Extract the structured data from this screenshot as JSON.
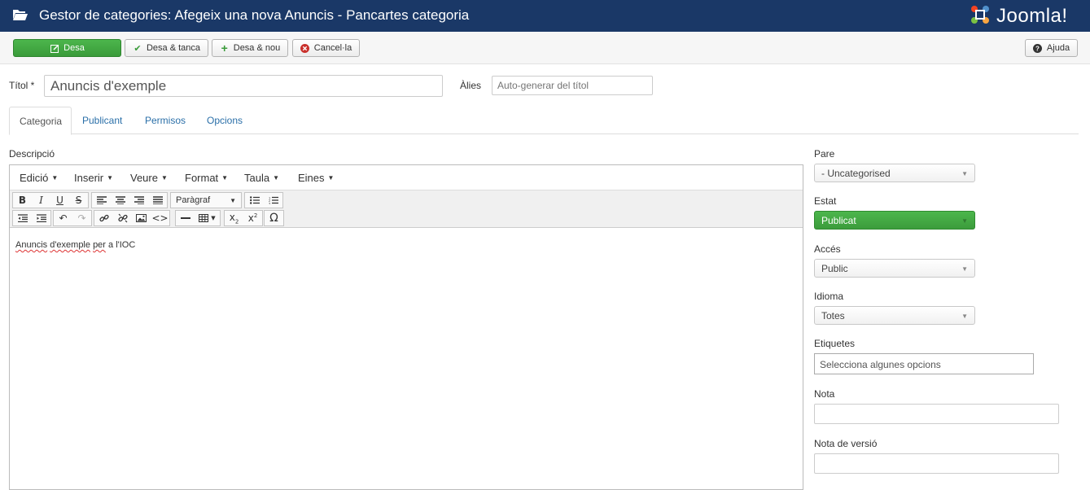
{
  "header": {
    "title": "Gestor de categories: Afegeix una nova Anuncis - Pancartes categoria",
    "logo_text": "Joomla!",
    "colors": {
      "background": "#1a3867",
      "text": "#ffffff"
    }
  },
  "toolbar": {
    "save": "Desa",
    "save_close": "Desa & tanca",
    "save_new": "Desa & nou",
    "cancel": "Cancel·la",
    "help": "Ajuda",
    "colors": {
      "primary": "#3fa53f"
    }
  },
  "form": {
    "title_label": "Títol *",
    "title_value": "Anuncis d'exemple",
    "alias_label": "Àlies",
    "alias_placeholder": "Auto-generar del títol"
  },
  "tabs": [
    {
      "label": "Categoria",
      "active": true
    },
    {
      "label": "Publicant",
      "active": false
    },
    {
      "label": "Permisos",
      "active": false
    },
    {
      "label": "Opcions",
      "active": false
    }
  ],
  "editor": {
    "description_label": "Descripció",
    "menus": [
      "Edició",
      "Inserir",
      "Veure",
      "Format",
      "Taula",
      "Eines"
    ],
    "format_select": "Paràgraf",
    "content_words": [
      "Anuncis",
      " ",
      "d'exemple",
      " ",
      "per",
      " a l'IOC"
    ]
  },
  "sidebar": {
    "parent_label": "Pare",
    "parent_value": "- Uncategorised",
    "status_label": "Estat",
    "status_value": "Publicat",
    "access_label": "Accés",
    "access_value": "Public",
    "language_label": "Idioma",
    "language_value": "Totes",
    "tags_label": "Etiquetes",
    "tags_placeholder": "Selecciona algunes opcions",
    "note_label": "Nota",
    "version_note_label": "Nota de versió"
  }
}
